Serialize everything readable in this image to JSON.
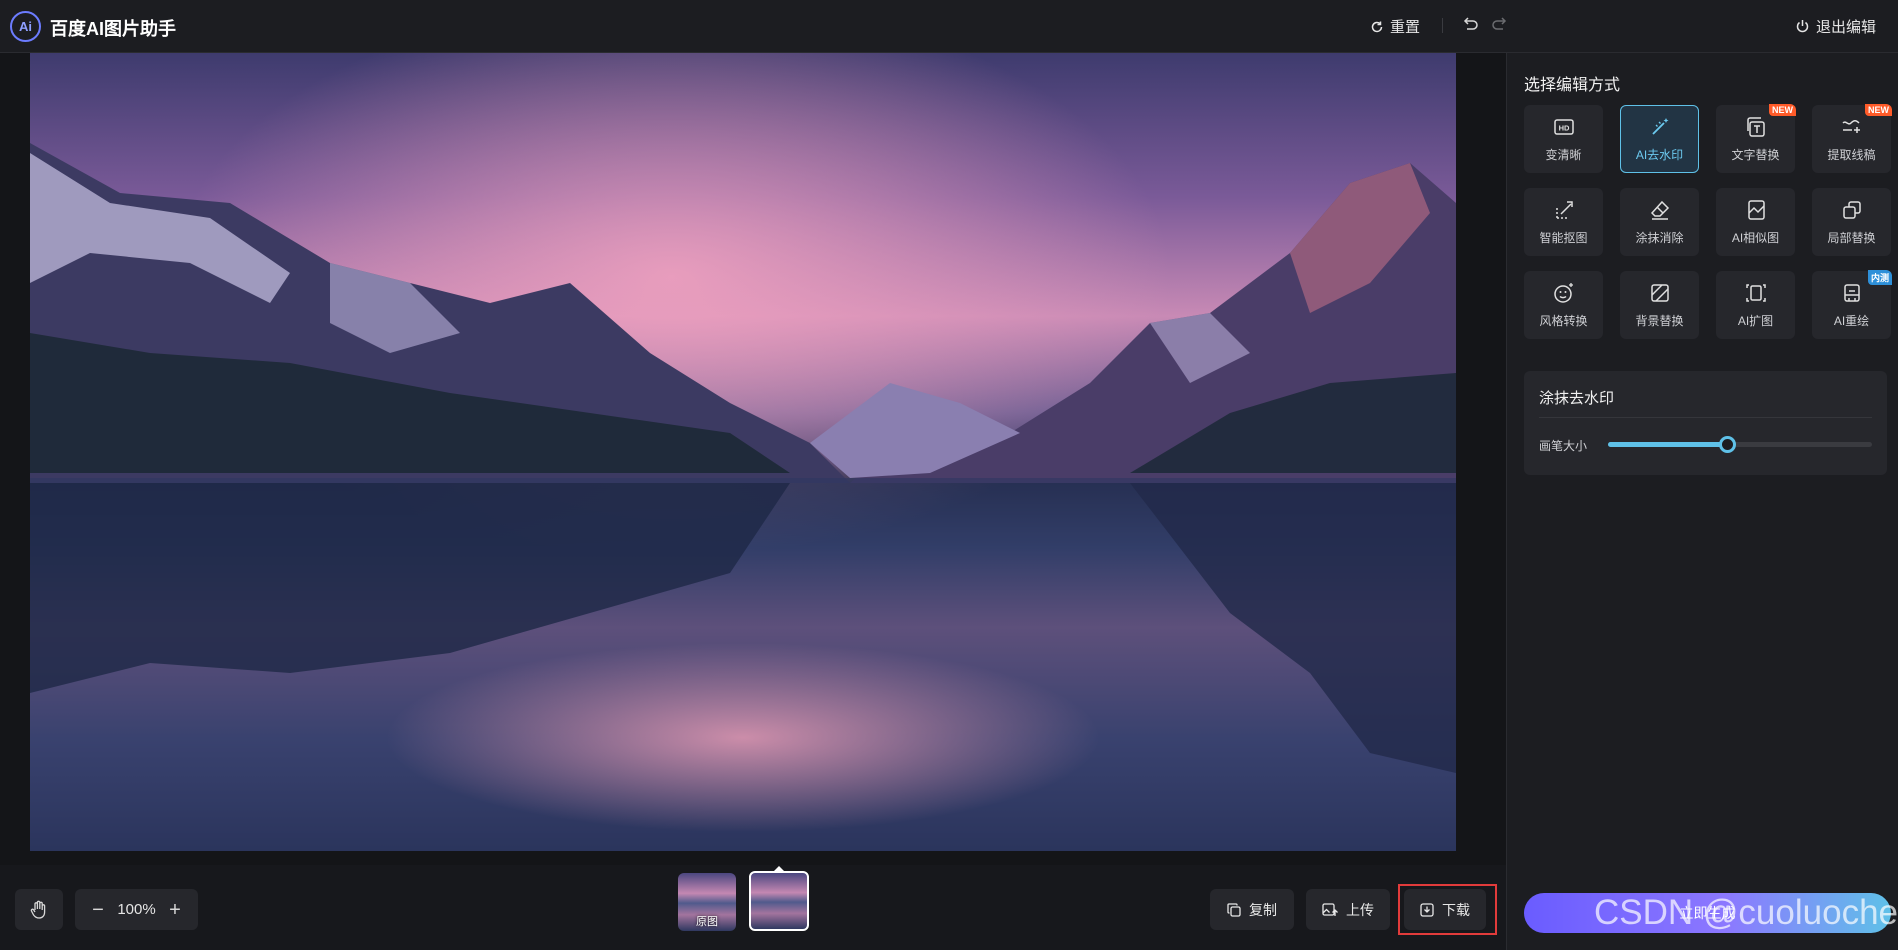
{
  "header": {
    "logo_text": "Ai",
    "app_title": "百度AI图片助手",
    "reset_label": "重置",
    "exit_label": "退出编辑"
  },
  "canvas": {
    "zoom_level": "100%"
  },
  "thumbnails": [
    {
      "label": "原图",
      "selected": false
    },
    {
      "label": "",
      "selected": true
    }
  ],
  "actions": {
    "copy_label": "复制",
    "upload_label": "上传",
    "download_label": "下载"
  },
  "panel": {
    "title": "选择编辑方式",
    "tools": [
      {
        "label": "变清晰",
        "icon": "hd-icon",
        "badge": ""
      },
      {
        "label": "AI去水印",
        "icon": "magic-wand-icon",
        "badge": "",
        "active": true
      },
      {
        "label": "文字替换",
        "icon": "text-replace-icon",
        "badge": "NEW"
      },
      {
        "label": "提取线稿",
        "icon": "line-extract-icon",
        "badge": "NEW"
      },
      {
        "label": "智能抠图",
        "icon": "cutout-icon",
        "badge": ""
      },
      {
        "label": "涂抹消除",
        "icon": "eraser-icon",
        "badge": ""
      },
      {
        "label": "AI相似图",
        "icon": "similar-image-icon",
        "badge": ""
      },
      {
        "label": "局部替换",
        "icon": "partial-replace-icon",
        "badge": ""
      },
      {
        "label": "风格转换",
        "icon": "style-transfer-icon",
        "badge": ""
      },
      {
        "label": "背景替换",
        "icon": "background-replace-icon",
        "badge": ""
      },
      {
        "label": "AI扩图",
        "icon": "expand-image-icon",
        "badge": ""
      },
      {
        "label": "AI重绘",
        "icon": "redraw-icon",
        "badge": "内测"
      }
    ],
    "brush": {
      "title": "涂抹去水印",
      "size_label": "画笔大小",
      "size_fraction": 0.45
    },
    "apply_label": "立即生成"
  },
  "watermark_text": "CSDN @cuoluoche",
  "colors": {
    "accent": "#5fc1e8",
    "highlight": "#e23b3b",
    "badge_new": "#ff5b29",
    "badge_inner": "#2e90d9"
  }
}
